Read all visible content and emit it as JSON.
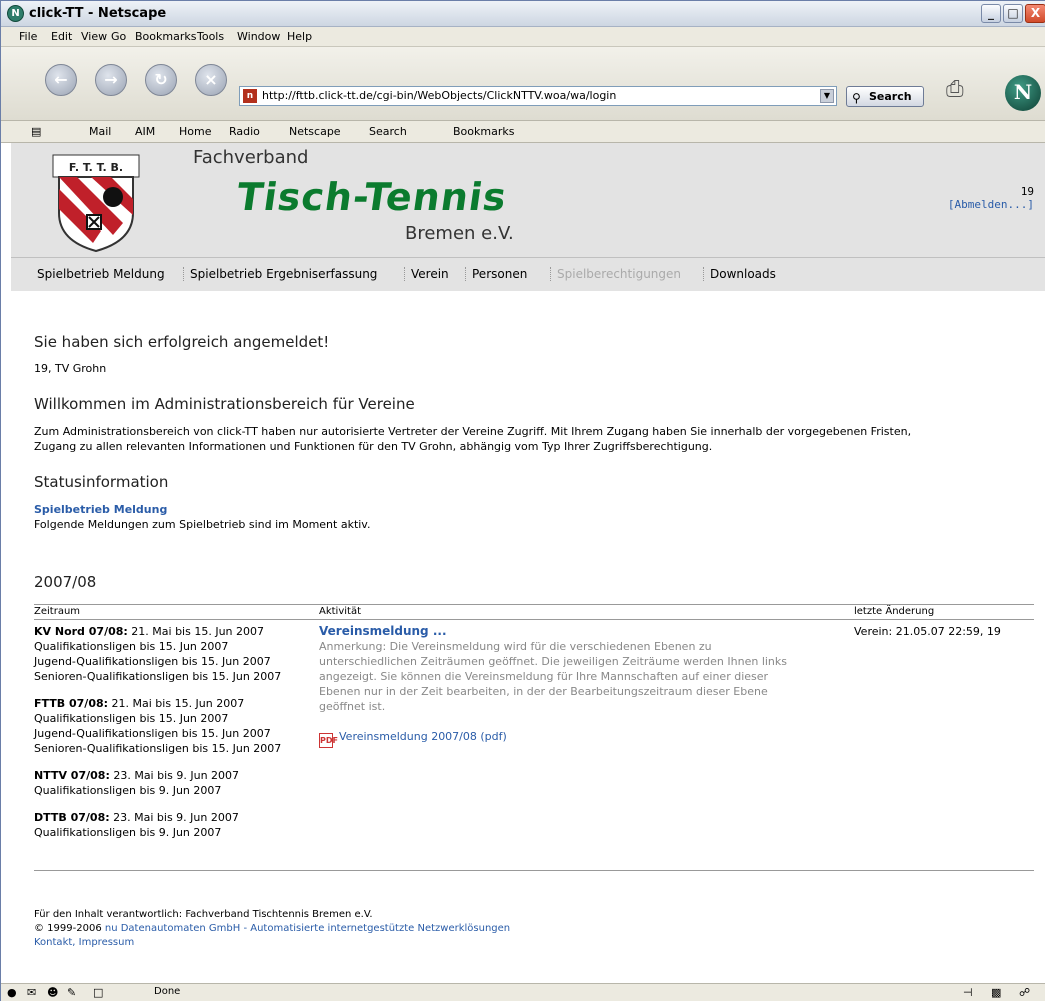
{
  "window": {
    "title": "click-TT - Netscape",
    "min_label": "_",
    "max_label": "□",
    "close_label": "X"
  },
  "menu": [
    "File",
    "Edit",
    "View",
    "Go",
    "Bookmarks",
    "Tools",
    "Window",
    "Help"
  ],
  "navigation": {
    "url": "http://fttb.click-tt.de/cgi-bin/WebObjects/ClickNTTV.woa/wa/login",
    "search_label": "Search"
  },
  "personal_toolbar": [
    "Mail",
    "AIM",
    "Home",
    "Radio",
    "Netscape",
    "Search",
    "Bookmarks"
  ],
  "site_header": {
    "line1": "Fachverband",
    "line2": "Tisch-Tennis",
    "line3": "Bremen e.V.",
    "crest_text": "F. T. T. B.",
    "user_id": "19",
    "logout": "[Abmelden...]"
  },
  "tabs": [
    {
      "label": "Spielbetrieb Meldung",
      "disabled": false
    },
    {
      "label": "Spielbetrieb Ergebniserfassung",
      "disabled": false
    },
    {
      "label": "Verein",
      "disabled": false
    },
    {
      "label": "Personen",
      "disabled": false
    },
    {
      "label": "Spielberechtigungen",
      "disabled": true
    },
    {
      "label": "Downloads",
      "disabled": false
    }
  ],
  "main": {
    "success": "Sie haben sich erfolgreich angemeldet!",
    "club": "19, TV Grohn",
    "welcome_heading": "Willkommen im Administrationsbereich für Vereine",
    "welcome_text_1": "Zum Administrationsbereich von click-TT haben nur autorisierte Vertreter der Vereine Zugriff. Mit Ihrem Zugang haben Sie innerhalb der vorgegebenen Fristen,",
    "welcome_text_2": "Zugang zu allen relevanten Informationen und Funktionen für den TV Grohn, abhängig vom Typ Ihrer Zugriffsberechtigung.",
    "status_heading": "Statusinformation",
    "status_link": "Spielbetrieb Meldung",
    "status_text": "Folgende Meldungen zum Spielbetrieb sind im Moment aktiv.",
    "season": "2007/08"
  },
  "table": {
    "headers": {
      "period": "Zeitraum",
      "activity": "Aktivität",
      "last_change": "letzte Änderung"
    },
    "periods": [
      {
        "name": "KV Nord 07/08:",
        "range": " 21. Mai bis 15. Jun 2007",
        "lines": [
          "Qualifikationsligen bis 15. Jun 2007",
          "Jugend-Qualifikationsligen bis 15. Jun 2007",
          "Senioren-Qualifikationsligen bis 15. Jun 2007"
        ]
      },
      {
        "name": "FTTB 07/08:",
        "range": " 21. Mai bis 15. Jun 2007",
        "lines": [
          "Qualifikationsligen bis 15. Jun 2007",
          "Jugend-Qualifikationsligen bis 15. Jun 2007",
          "Senioren-Qualifikationsligen bis 15. Jun 2007"
        ]
      },
      {
        "name": "NTTV 07/08:",
        "range": " 23. Mai bis 9. Jun 2007",
        "lines": [
          "Qualifikationsligen bis 9. Jun 2007"
        ]
      },
      {
        "name": "DTTB 07/08:",
        "range": " 23. Mai bis 9. Jun 2007",
        "lines": [
          "Qualifikationsligen bis 9. Jun 2007"
        ]
      }
    ],
    "activity_link": "Vereinsmeldung ...",
    "note_lines": [
      "Anmerkung: Die Vereinsmeldung wird für die verschiedenen Ebenen zu",
      "unterschiedlichen Zeiträumen geöffnet. Die jeweiligen Zeiträume werden Ihnen links",
      "angezeigt. Sie können die Vereinsmeldung für Ihre Mannschaften auf einer dieser",
      "Ebenen nur in der Zeit bearbeiten, in der der Bearbeitungszeitraum dieser Ebene",
      "geöffnet ist."
    ],
    "pdf_link": "Vereinsmeldung 2007/08 (pdf)",
    "last_change": "Verein: 21.05.07 22:59, 19"
  },
  "footer": {
    "responsible": "Für den Inhalt verantwortlich: Fachverband Tischtennis Bremen e.V.",
    "copyright_prefix": "© 1999-2006 ",
    "copyright_link": "nu Datenautomaten GmbH - Automatisierte internetgestützte Netzwerklösungen",
    "contact": "Kontakt",
    "impressum": "Impressum"
  },
  "statusbar": {
    "text": "Done"
  }
}
